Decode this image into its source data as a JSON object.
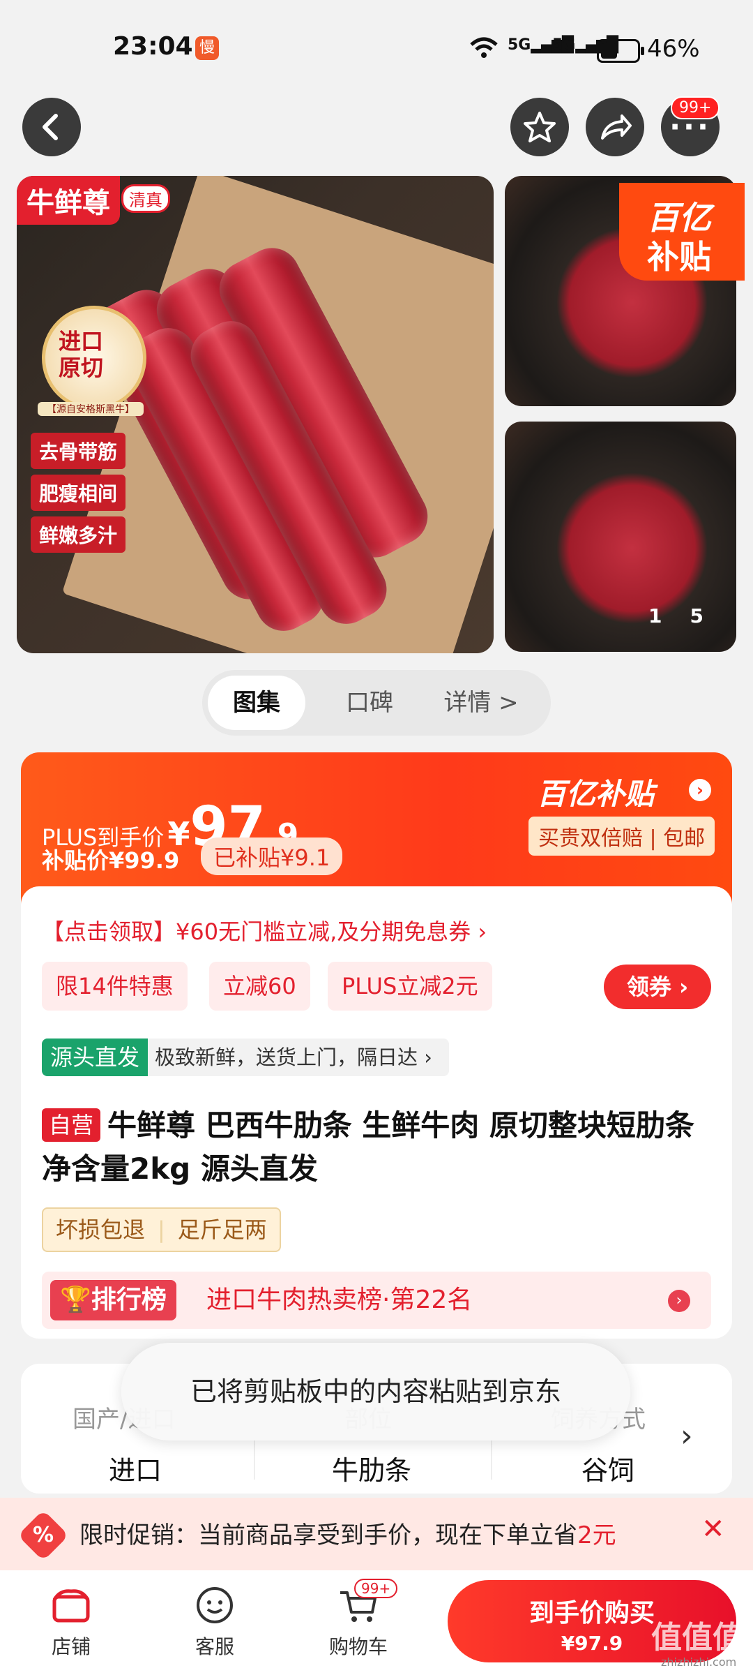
{
  "status": {
    "time": "23:04",
    "battery_pct": "46%",
    "battery_level": 0.46,
    "network": "5G"
  },
  "nav": {
    "back_icon": "chevron-left",
    "fav_icon": "star",
    "share_icon": "share",
    "more_icon": "more",
    "more_badge": "99+"
  },
  "gallery": {
    "brand": "牛鲜尊",
    "halal": "清真",
    "import_line1": "进口",
    "import_line2": "原切",
    "import_sub": "【源自安格斯黑牛】",
    "tags": [
      "去骨带筋",
      "肥瘦相间",
      "鲜嫩多汁"
    ],
    "subsidy_corner_line1": "百亿",
    "subsidy_corner_line2": "补贴",
    "pager_current": "1",
    "pager_total": "5"
  },
  "tabs": [
    "图集",
    "口碑",
    "详情 >"
  ],
  "price": {
    "plus_label": "PLUS到手价",
    "currency": "¥",
    "big": "97",
    "decimal": ".9",
    "subsidy_price": "补贴价¥99.9",
    "subsidized": "已补贴¥9.1",
    "yibutie": "百亿补贴",
    "guarantee": "买贵双倍赔 | 包邮"
  },
  "coupon": {
    "line": "【点击领取】¥60无门槛立减,及分期免息券 ›",
    "chips": [
      "限14件特惠",
      "立减60",
      "PLUS立减2元"
    ],
    "lingquan": "领券"
  },
  "source": {
    "tag": "源头直发",
    "text": "极致新鲜，送货上门，隔日达 ›"
  },
  "product": {
    "self": "自营",
    "title": "牛鲜尊 巴西牛肋条 生鲜牛肉 原切整块短肋条 净含量2kg 源头直发"
  },
  "service_tags": [
    "坏损包退",
    "足斤足两"
  ],
  "rank": {
    "tag": "排行榜",
    "text": "进口牛肉热卖榜·第22名",
    "chev": "›"
  },
  "specs": {
    "headers": [
      "国产/进口",
      "部位",
      "饲养方式"
    ],
    "values": [
      "进口",
      "牛肋条",
      "谷饲"
    ]
  },
  "toast": "已将剪贴板中的内容粘贴到京东",
  "promo": {
    "icon": "%",
    "text_a": "限时促销：当前商品享受到手价，现在下单立省",
    "text_b": "2元",
    "close": "✕"
  },
  "bottom": {
    "store": "店铺",
    "service": "客服",
    "cart": "购物车",
    "cart_badge": "99+",
    "buy_line1": "到手价购买",
    "buy_line2": "¥97.9",
    "watermark": "值值值",
    "watermark_url": "zhizhizhi.com"
  },
  "colors": {
    "accent": "#e3202e",
    "orange": "#ff4a10",
    "green": "#1aa36b"
  }
}
